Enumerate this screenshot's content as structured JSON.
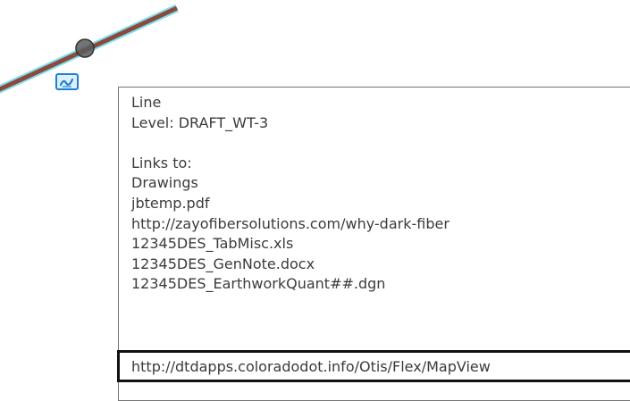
{
  "tooltip": {
    "element_type": "Line",
    "level": "Level: DRAFT_WT-3",
    "links_heading": "Links to:",
    "links": [
      "Drawings",
      "jbtemp.pdf",
      "http://zayofibersolutions.com/why-dark-fiber",
      "12345DES_TabMisc.xls",
      "12345DES_GenNote.docx",
      "12345DES_EarthworkQuant##.dgn"
    ],
    "highlighted_link": "http://dtdapps.coloradodot.info/Otis/Flex/MapView"
  },
  "graphics": {
    "line_color": "#8b4a3c",
    "line_halo_color": "#7ee0ee",
    "vertex_color": "#555555",
    "badge_color": "#1e7fd6",
    "badge_icon": "link-badge-icon"
  }
}
